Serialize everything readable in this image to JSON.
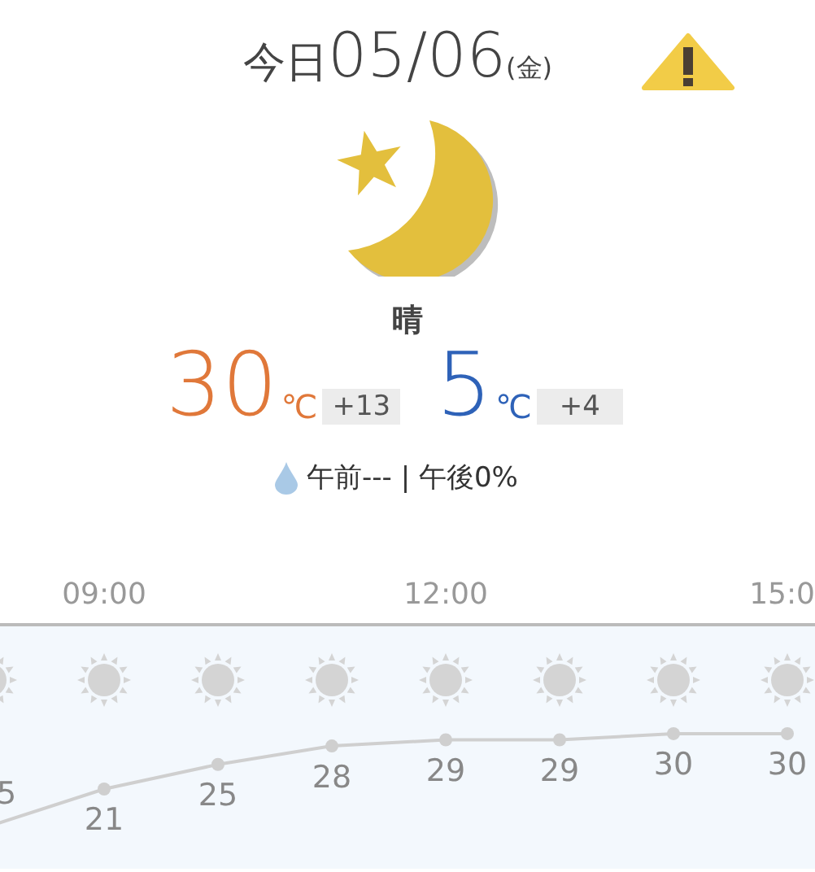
{
  "header": {
    "today_label": "今日",
    "date": "05/06",
    "weekday": "(金)"
  },
  "weather": {
    "condition": "晴"
  },
  "high": {
    "temp": "30",
    "unit": "℃",
    "diff": "+13"
  },
  "low": {
    "temp": "5",
    "unit": "℃",
    "diff": "+4"
  },
  "precipitation": "午前--- | 午後0%",
  "hourly": {
    "times": [
      {
        "label": "09:00"
      },
      {
        "label": "12:00"
      },
      {
        "label": "15:0"
      }
    ],
    "hours": [
      {
        "temp": "5"
      },
      {
        "temp": "21"
      },
      {
        "temp": "25"
      },
      {
        "temp": "28"
      },
      {
        "temp": "29"
      },
      {
        "temp": "29"
      },
      {
        "temp": "30"
      },
      {
        "temp": "30"
      }
    ]
  }
}
